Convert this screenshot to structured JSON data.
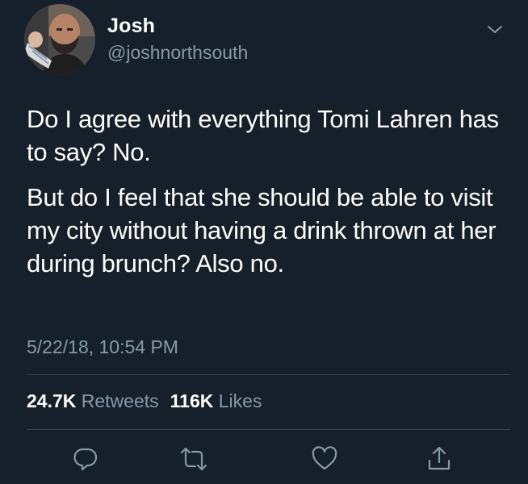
{
  "user": {
    "display_name": "Josh",
    "handle": "@joshnorthsouth"
  },
  "tweet": {
    "paragraphs": [
      "Do I agree with everything Tomi Lahren has to say? No.",
      "But do I feel that she should be able to visit my city without having a drink thrown at her during brunch? Also no."
    ],
    "timestamp": "5/22/18, 10:54 PM"
  },
  "stats": {
    "retweets_count": "24.7K",
    "retweets_label": "Retweets",
    "likes_count": "116K",
    "likes_label": "Likes"
  },
  "actions": {
    "icons": [
      "reply-icon",
      "retweet-icon",
      "like-icon",
      "share-icon"
    ]
  },
  "colors": {
    "background": "#15202b",
    "text_primary": "#ffffff",
    "text_secondary": "#8899a6",
    "divider": "#38444d"
  }
}
